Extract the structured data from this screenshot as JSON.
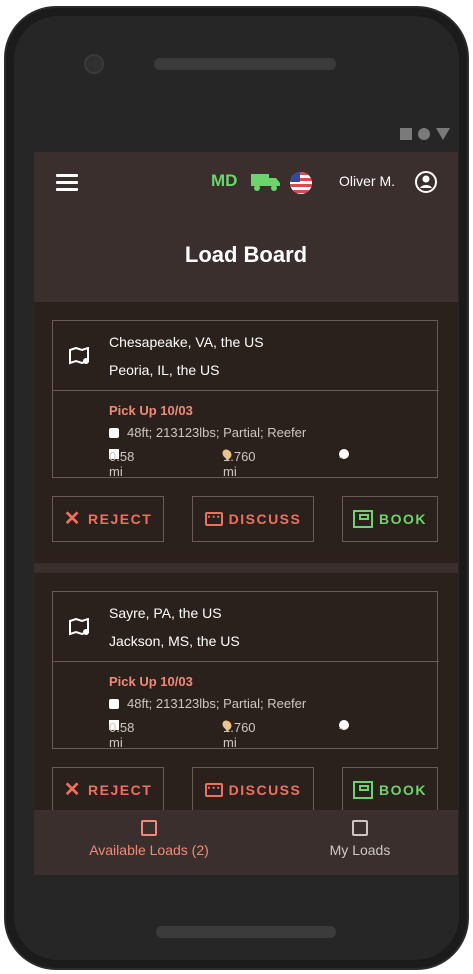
{
  "header": {
    "md_label": "MD",
    "user_name": "Oliver M.",
    "title": "Load Board"
  },
  "buttons": {
    "reject": "REJECT",
    "discuss": "DISCUSS",
    "book": "BOOK"
  },
  "loads": [
    {
      "origin": "Chesapeake, VA, the US",
      "destination": "Peoria, IL, the US",
      "pickup": "Pick Up 10/03",
      "spec": "48ft; 213123lbs; Partial; Reefer",
      "distance": "0.58 mi",
      "location": "1.760 mi",
      "price": "-"
    },
    {
      "origin": "Sayre, PA, the US",
      "destination": "Jackson, MS, the US",
      "pickup": "Pick Up 10/03",
      "spec": "48ft; 213123lbs; Partial; Reefer",
      "distance": "0.58 mi",
      "location": "1.760 mi",
      "price": "-"
    }
  ],
  "nav": {
    "available": "Available Loads (2)",
    "my_loads": "My Loads"
  },
  "colors": {
    "accent_red": "#f07060",
    "accent_green": "#6dd46d"
  }
}
